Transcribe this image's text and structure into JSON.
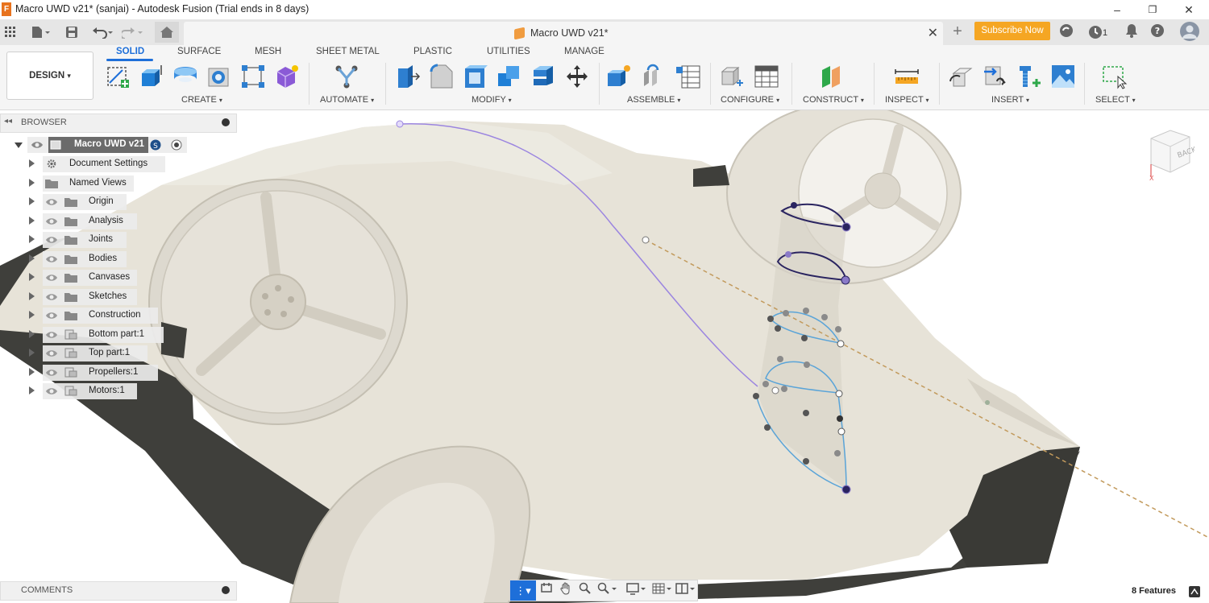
{
  "window": {
    "title": "Macro UWD v21* (sanjai) - Autodesk Fusion (Trial ends in 8 days)",
    "app_icon_letter": "F",
    "controls": [
      "–",
      "❐",
      "✕"
    ]
  },
  "tabbar": {
    "document_tab": "Macro UWD v21*",
    "close_glyph": "✕",
    "new_tab_glyph": "+",
    "subscribe_label": "Subscribe Now",
    "job_count": "1"
  },
  "ribbon": {
    "workspace": "DESIGN",
    "tabs": [
      "SOLID",
      "SURFACE",
      "MESH",
      "SHEET METAL",
      "PLASTIC",
      "UTILITIES",
      "MANAGE"
    ],
    "active_tab": "SOLID",
    "groups": [
      "CREATE",
      "AUTOMATE",
      "MODIFY",
      "ASSEMBLE",
      "CONFIGURE",
      "CONSTRUCT",
      "INSPECT",
      "INSERT",
      "SELECT"
    ],
    "dropdown_glyph": "▾"
  },
  "browser": {
    "title": "BROWSER",
    "root": "Macro UWD v21",
    "items": [
      {
        "label": "Document Settings",
        "icon": "gear-icon"
      },
      {
        "label": "Named Views",
        "icon": "folder-icon"
      },
      {
        "label": "Origin",
        "icon": "folder-icon"
      },
      {
        "label": "Analysis",
        "icon": "folder-icon"
      },
      {
        "label": "Joints",
        "icon": "folder-icon"
      },
      {
        "label": "Bodies",
        "icon": "folder-icon"
      },
      {
        "label": "Canvases",
        "icon": "folder-icon"
      },
      {
        "label": "Sketches",
        "icon": "folder-icon"
      },
      {
        "label": "Construction",
        "icon": "folder-icon"
      },
      {
        "label": "Bottom part:1",
        "icon": "component-icon"
      },
      {
        "label": "Top part:1",
        "icon": "component-icon"
      },
      {
        "label": "Propellers:1",
        "icon": "component-icon"
      },
      {
        "label": "Motors:1",
        "icon": "component-icon"
      }
    ]
  },
  "comments": {
    "title": "COMMENTS"
  },
  "status": {
    "features": "8 Features"
  },
  "viewcube": {
    "face": "BACK",
    "axis_x": "X"
  },
  "colors": {
    "accent": "#1e6fd9",
    "subscribe": "#f5a623",
    "body": "#e8e4da",
    "shadow": "#3f3f3b"
  }
}
